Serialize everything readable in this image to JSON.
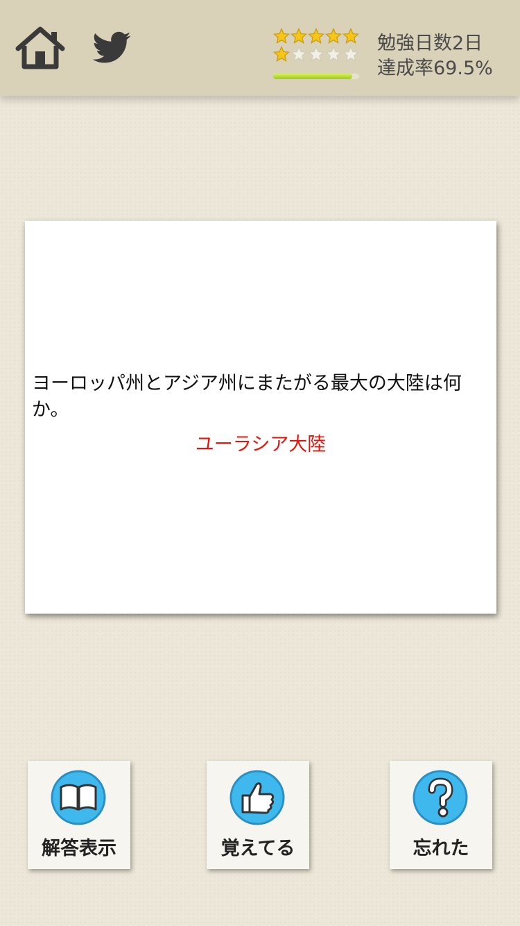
{
  "header": {
    "home_icon": "home-icon",
    "twitter_icon": "twitter-icon",
    "stars_filled_row1": 5,
    "stars_filled_row2": 1,
    "stars_per_row": 5,
    "progress_fraction": 0.92,
    "study_days": "勉強日数2日",
    "achievement_rate": "達成率69.5%",
    "accent_progress_color": "#9ccc1a",
    "star_color": "#f5c518"
  },
  "card": {
    "question": "ヨーロッパ州とアジア州にまたがる最大の大陸は何か。",
    "answer": "ユーラシア大陸",
    "answer_color": "#e8140c"
  },
  "actions": {
    "show_answer_label": "解答表示",
    "remembered_label": "覚えてる",
    "forgot_label": "忘れた",
    "show_answer_icon": "book-icon",
    "remembered_icon": "thumbs-up-icon",
    "forgot_icon": "question-icon",
    "icon_color": "#3fb8ee"
  }
}
